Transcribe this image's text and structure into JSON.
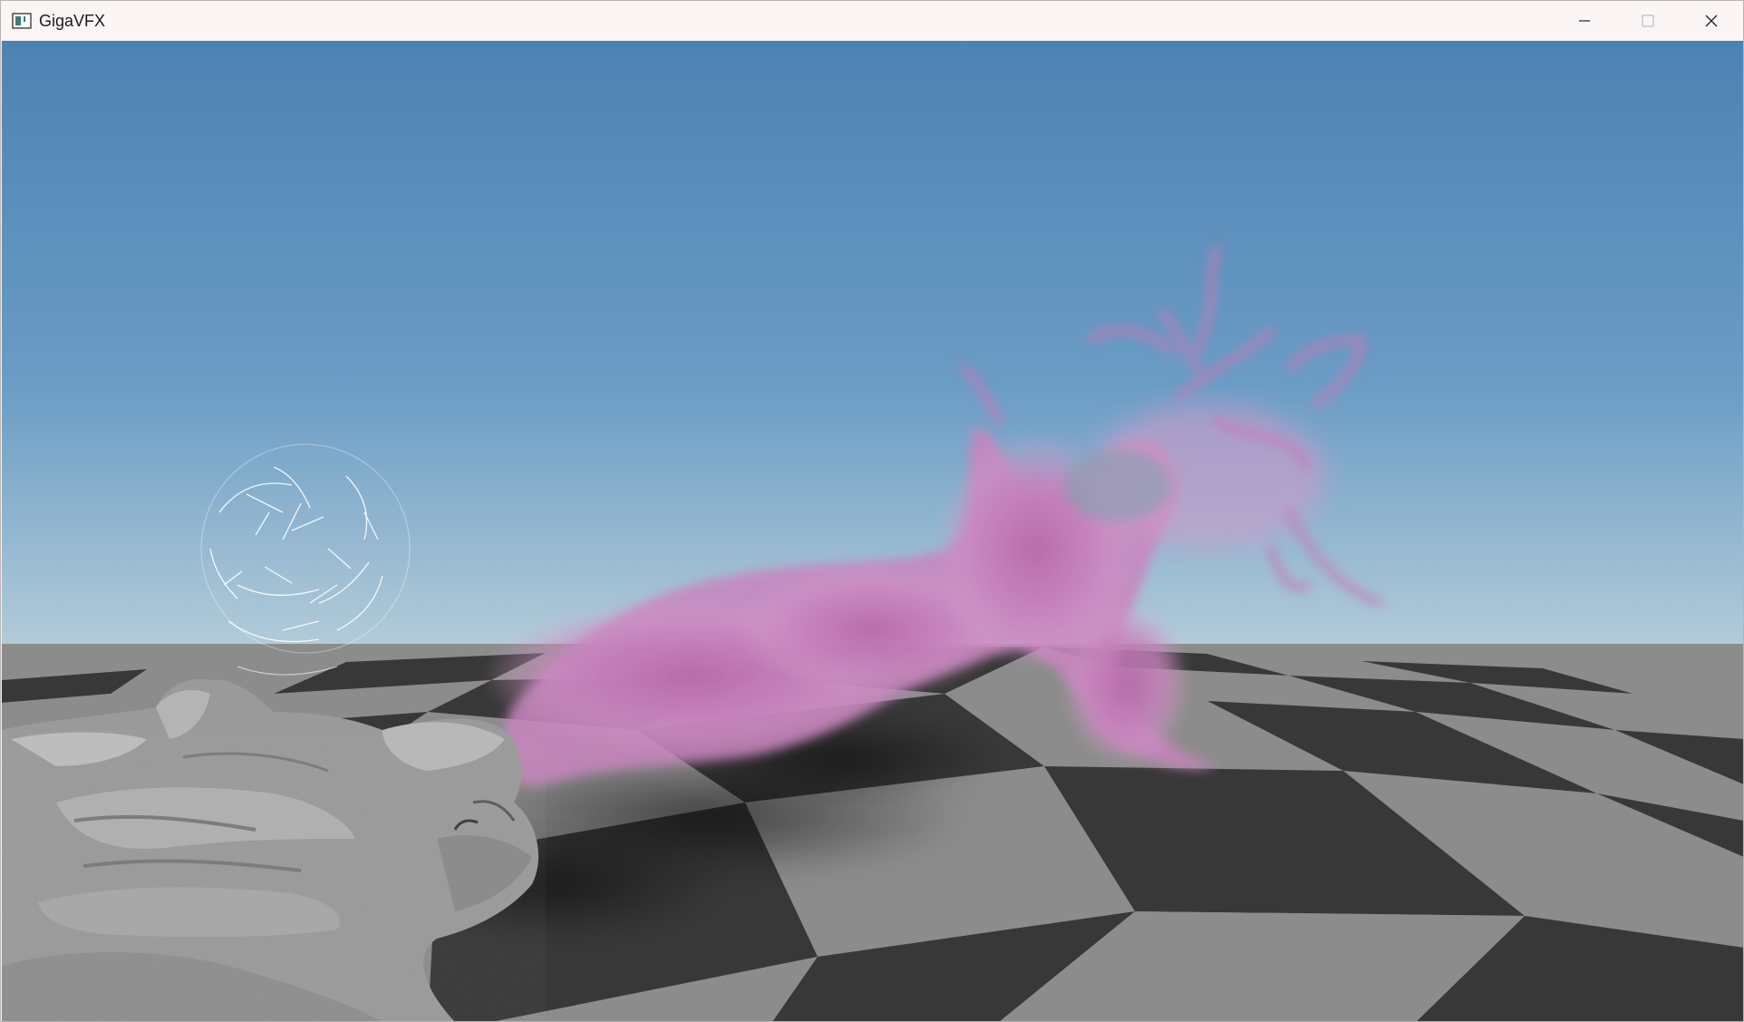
{
  "window": {
    "title": "GigaVFX",
    "icon": "app-window-icon",
    "controls": {
      "minimize_icon": "minimize-icon",
      "maximize_icon": "maximize-icon",
      "close_icon": "close-icon"
    }
  },
  "scene": {
    "sky_top_color": "#4e82b3",
    "sky_horizon_color": "#dde6ea",
    "floor_dark_color": "#383838",
    "floor_light_color": "#8c8c8c",
    "smoke_color": "#c884be",
    "dragon_color": "#9a9a9a",
    "particle_sphere_color": "#ffffff"
  }
}
